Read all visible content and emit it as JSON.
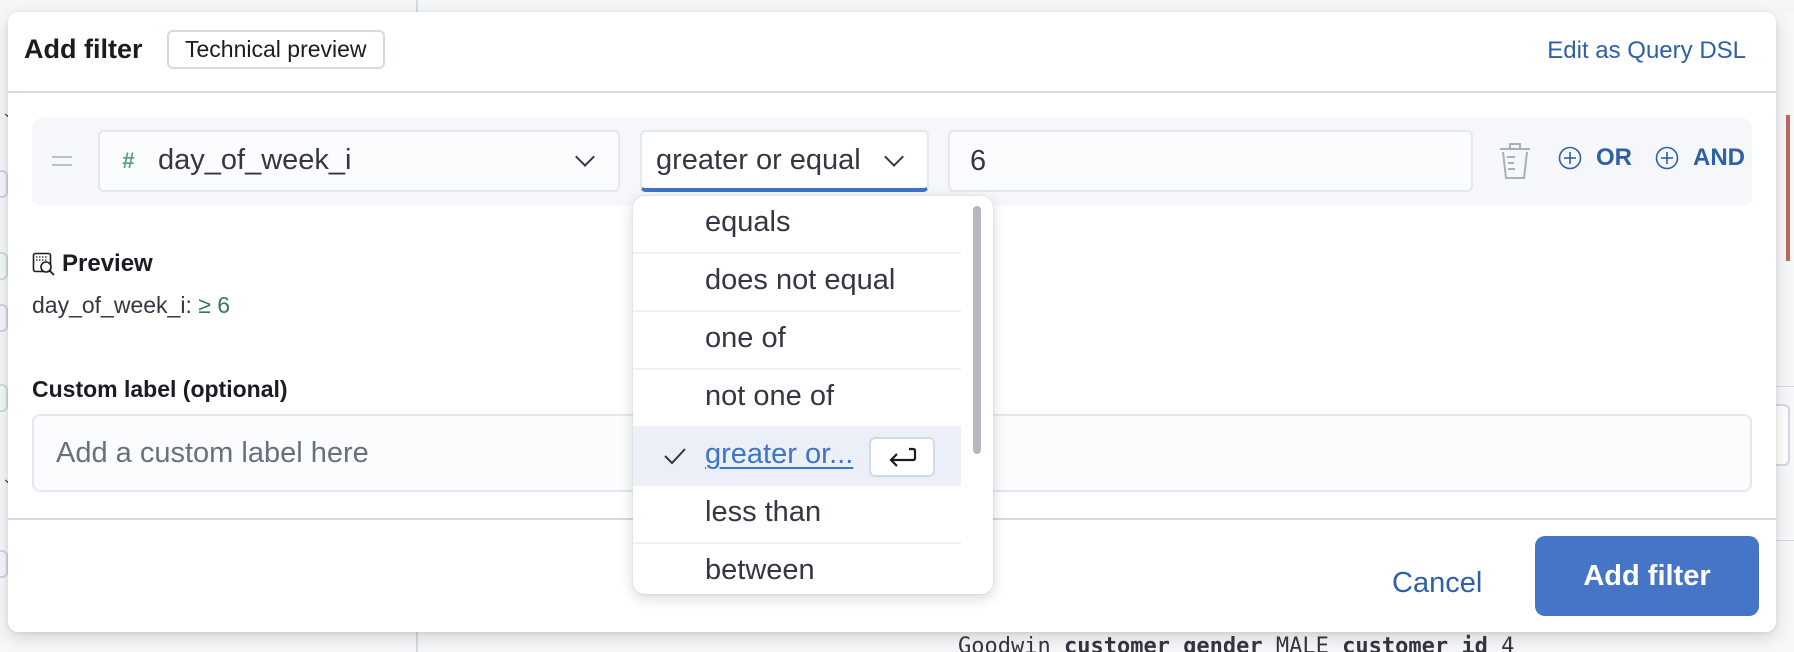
{
  "background": {
    "document_snippet": {
      "parts": [
        {
          "text": "Goodwin ",
          "bold": false
        },
        {
          "text": "customer_gender",
          "bold": true
        },
        {
          "text": " MALE ",
          "bold": false
        },
        {
          "text": "customer_id",
          "bold": true
        },
        {
          "text": " 4",
          "bold": false
        }
      ]
    }
  },
  "modal": {
    "title": "Add filter",
    "badge": "Technical preview",
    "edit_dsl_label": "Edit as Query DSL",
    "filter_row": {
      "field": {
        "type_icon": "number-hash-icon",
        "value": "day_of_week_i"
      },
      "operator": {
        "value": "greater or equal"
      },
      "value_input": "6",
      "or_label": "OR",
      "and_label": "AND"
    },
    "preview": {
      "title": "Preview",
      "field": "day_of_week_i:",
      "expression": "≥ 6"
    },
    "custom_label": {
      "title": "Custom label (optional)",
      "placeholder": "Add a custom label here",
      "value": ""
    },
    "footer": {
      "cancel_label": "Cancel",
      "submit_label": "Add filter"
    }
  },
  "operator_dropdown": {
    "items": [
      {
        "label": "equals",
        "selected": false
      },
      {
        "label": "does not equal",
        "selected": false
      },
      {
        "label": "one of",
        "selected": false
      },
      {
        "label": "not one of",
        "selected": false
      },
      {
        "label": "greater or...",
        "selected": true
      },
      {
        "label": "less than",
        "selected": false
      },
      {
        "label": "between",
        "selected": false
      }
    ],
    "selected_hint_icon": "enter-key-icon"
  },
  "colors": {
    "accent": "#3f73c9",
    "link": "#2f5fa6",
    "primary_button": "#4675c8",
    "preview_operator": "#387765",
    "field_type_icon": "#54a27d"
  }
}
